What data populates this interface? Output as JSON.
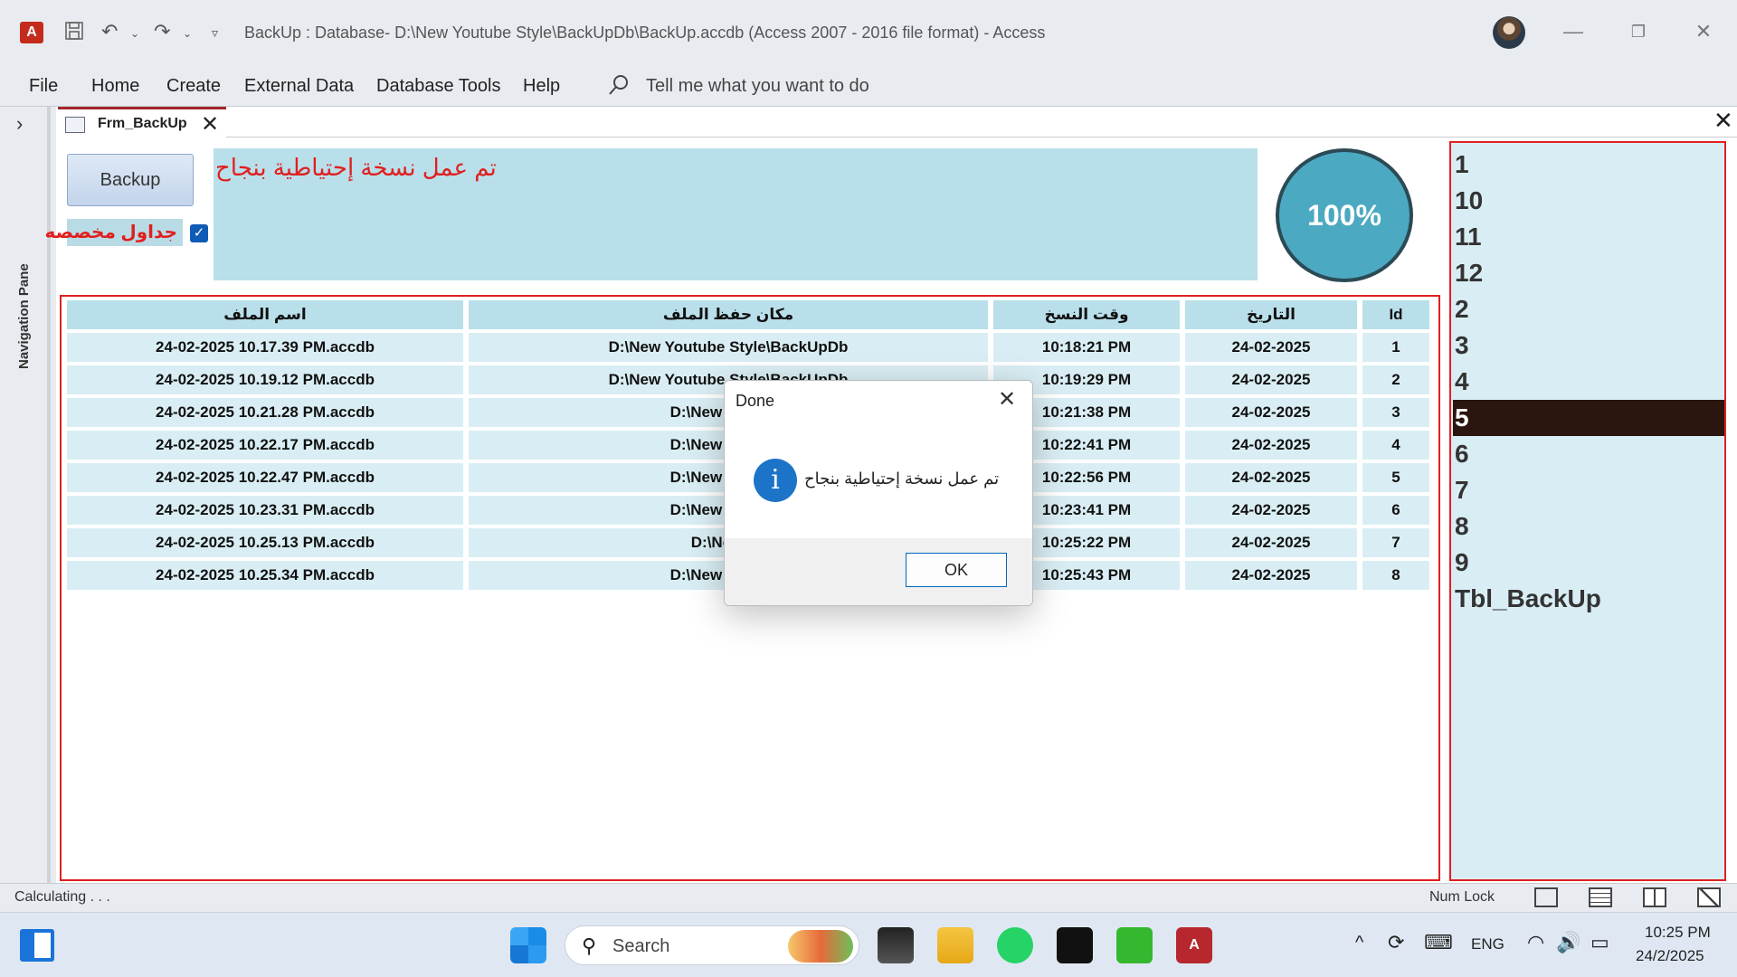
{
  "window": {
    "title": "BackUp : Database- D:\\New Youtube Style\\BackUpDb\\BackUp.accdb (Access 2007 - 2016 file format)  -  Access",
    "app_icon_letter": "A"
  },
  "ribbon": {
    "tabs": [
      "File",
      "Home",
      "Create",
      "External Data",
      "Database Tools",
      "Help"
    ],
    "tell_me": "Tell me what you want to do"
  },
  "nav_pane": {
    "label": "Navigation Pane"
  },
  "doc_tab": {
    "label": "Frm_BackUp"
  },
  "form": {
    "backup_button": "Backup",
    "custom_tables_label": "جداول مخصصه",
    "custom_tables_checked": true,
    "message": "تم عمل نسخة إحتياطية بنجاح",
    "progress_text": "100%",
    "progress_value": 1.0
  },
  "table": {
    "columns": [
      "اسم الملف",
      "مكان حفظ الملف",
      "وقت النسخ",
      "التاريخ",
      "Id"
    ],
    "rows": [
      [
        "24-02-2025 10.17.39 PM.accdb",
        "D:\\New Youtube Style\\BackUpDb",
        "10:18:21 PM",
        "24-02-2025",
        "1"
      ],
      [
        "24-02-2025 10.19.12 PM.accdb",
        "D:\\New Youtube Style\\BackUpDb",
        "10:19:29 PM",
        "24-02-2025",
        "2"
      ],
      [
        "24-02-2025 10.21.28 PM.accdb",
        "D:\\New Youtube",
        "10:21:38 PM",
        "24-02-2025",
        "3"
      ],
      [
        "24-02-2025 10.22.17 PM.accdb",
        "D:\\New Youtube",
        "10:22:41 PM",
        "24-02-2025",
        "4"
      ],
      [
        "24-02-2025 10.22.47 PM.accdb",
        "D:\\New Youtube",
        "10:22:56 PM",
        "24-02-2025",
        "5"
      ],
      [
        "24-02-2025 10.23.31 PM.accdb",
        "D:\\New Youtube",
        "10:23:41 PM",
        "24-02-2025",
        "6"
      ],
      [
        "24-02-2025 10.25.13 PM.accdb",
        "D:\\New Yo",
        "10:25:22 PM",
        "24-02-2025",
        "7"
      ],
      [
        "24-02-2025 10.25.34 PM.accdb",
        "D:\\New Youtube",
        "10:25:43 PM",
        "24-02-2025",
        "8"
      ]
    ]
  },
  "list": {
    "items": [
      "1",
      "10",
      "11",
      "12",
      "2",
      "3",
      "4",
      "5",
      "6",
      "7",
      "8",
      "9",
      "Tbl_BackUp"
    ],
    "selected_index": 7
  },
  "dialog": {
    "title": "Done",
    "message": "تم عمل نسخة إحتياطية بنجاح",
    "ok_label": "OK",
    "icon": "info-icon"
  },
  "status": {
    "left": "Calculating . . .",
    "numlock": "Num Lock"
  },
  "taskbar": {
    "search_placeholder": "Search",
    "language": "ENG",
    "time": "10:25 PM",
    "date": "24/2/2025"
  },
  "colors": {
    "accent_red": "#e02020",
    "panel_blue": "#b9dfea",
    "selected_row": "#2a150f",
    "progress": "#4ba9c2"
  }
}
